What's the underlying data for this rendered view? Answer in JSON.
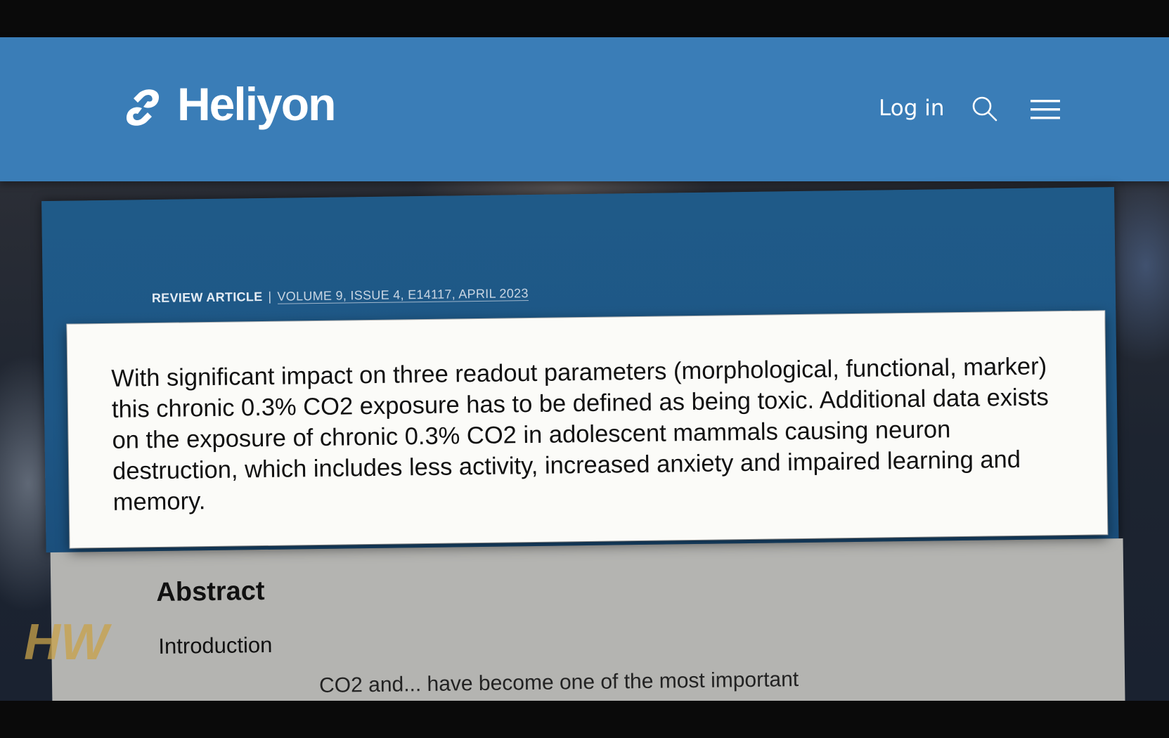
{
  "header": {
    "logo_text": "Heliyon",
    "login_label": "Log in",
    "search_icon": "search-icon",
    "menu_icon": "hamburger-menu-icon",
    "background_color": "#3a7db7"
  },
  "article": {
    "type": "REVIEW ARTICLE",
    "separator": "|",
    "citation": "VOLUME 9, ISSUE 4, E14117, APRIL 2023",
    "quote": "With significant impact on three readout parameters (morphological, functional, marker) this chronic 0.3% CO2 exposure has to be defined as being toxic. Additional data exists on the exposure of chronic 0.3% CO2 in adolescent mammals causing neuron destruction, which includes less activity, increased anxiety and impaired learning and memory.",
    "abstract_heading": "Abstract",
    "intro_heading": "Introduction",
    "cut_off_text": "CO2 and... have become one of the most important"
  },
  "watermark": {
    "text": "HW"
  }
}
